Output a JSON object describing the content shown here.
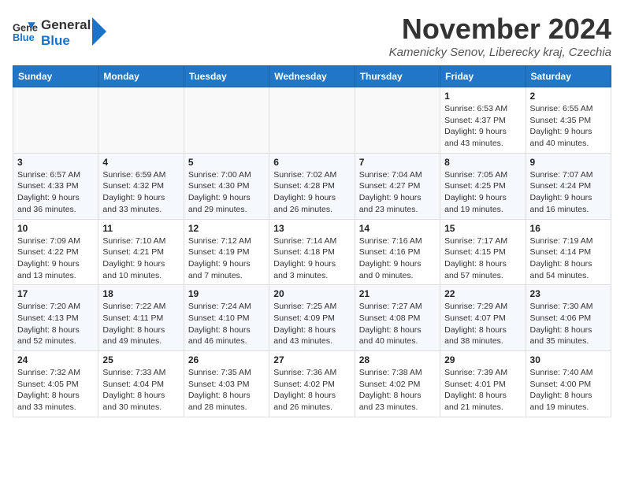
{
  "logo": {
    "line1": "General",
    "line2": "Blue"
  },
  "title": "November 2024",
  "subtitle": "Kamenicky Senov, Liberecky kraj, Czechia",
  "weekdays": [
    "Sunday",
    "Monday",
    "Tuesday",
    "Wednesday",
    "Thursday",
    "Friday",
    "Saturday"
  ],
  "weeks": [
    [
      {
        "day": "",
        "info": ""
      },
      {
        "day": "",
        "info": ""
      },
      {
        "day": "",
        "info": ""
      },
      {
        "day": "",
        "info": ""
      },
      {
        "day": "",
        "info": ""
      },
      {
        "day": "1",
        "info": "Sunrise: 6:53 AM\nSunset: 4:37 PM\nDaylight: 9 hours\nand 43 minutes."
      },
      {
        "day": "2",
        "info": "Sunrise: 6:55 AM\nSunset: 4:35 PM\nDaylight: 9 hours\nand 40 minutes."
      }
    ],
    [
      {
        "day": "3",
        "info": "Sunrise: 6:57 AM\nSunset: 4:33 PM\nDaylight: 9 hours\nand 36 minutes."
      },
      {
        "day": "4",
        "info": "Sunrise: 6:59 AM\nSunset: 4:32 PM\nDaylight: 9 hours\nand 33 minutes."
      },
      {
        "day": "5",
        "info": "Sunrise: 7:00 AM\nSunset: 4:30 PM\nDaylight: 9 hours\nand 29 minutes."
      },
      {
        "day": "6",
        "info": "Sunrise: 7:02 AM\nSunset: 4:28 PM\nDaylight: 9 hours\nand 26 minutes."
      },
      {
        "day": "7",
        "info": "Sunrise: 7:04 AM\nSunset: 4:27 PM\nDaylight: 9 hours\nand 23 minutes."
      },
      {
        "day": "8",
        "info": "Sunrise: 7:05 AM\nSunset: 4:25 PM\nDaylight: 9 hours\nand 19 minutes."
      },
      {
        "day": "9",
        "info": "Sunrise: 7:07 AM\nSunset: 4:24 PM\nDaylight: 9 hours\nand 16 minutes."
      }
    ],
    [
      {
        "day": "10",
        "info": "Sunrise: 7:09 AM\nSunset: 4:22 PM\nDaylight: 9 hours\nand 13 minutes."
      },
      {
        "day": "11",
        "info": "Sunrise: 7:10 AM\nSunset: 4:21 PM\nDaylight: 9 hours\nand 10 minutes."
      },
      {
        "day": "12",
        "info": "Sunrise: 7:12 AM\nSunset: 4:19 PM\nDaylight: 9 hours\nand 7 minutes."
      },
      {
        "day": "13",
        "info": "Sunrise: 7:14 AM\nSunset: 4:18 PM\nDaylight: 9 hours\nand 3 minutes."
      },
      {
        "day": "14",
        "info": "Sunrise: 7:16 AM\nSunset: 4:16 PM\nDaylight: 9 hours\nand 0 minutes."
      },
      {
        "day": "15",
        "info": "Sunrise: 7:17 AM\nSunset: 4:15 PM\nDaylight: 8 hours\nand 57 minutes."
      },
      {
        "day": "16",
        "info": "Sunrise: 7:19 AM\nSunset: 4:14 PM\nDaylight: 8 hours\nand 54 minutes."
      }
    ],
    [
      {
        "day": "17",
        "info": "Sunrise: 7:20 AM\nSunset: 4:13 PM\nDaylight: 8 hours\nand 52 minutes."
      },
      {
        "day": "18",
        "info": "Sunrise: 7:22 AM\nSunset: 4:11 PM\nDaylight: 8 hours\nand 49 minutes."
      },
      {
        "day": "19",
        "info": "Sunrise: 7:24 AM\nSunset: 4:10 PM\nDaylight: 8 hours\nand 46 minutes."
      },
      {
        "day": "20",
        "info": "Sunrise: 7:25 AM\nSunset: 4:09 PM\nDaylight: 8 hours\nand 43 minutes."
      },
      {
        "day": "21",
        "info": "Sunrise: 7:27 AM\nSunset: 4:08 PM\nDaylight: 8 hours\nand 40 minutes."
      },
      {
        "day": "22",
        "info": "Sunrise: 7:29 AM\nSunset: 4:07 PM\nDaylight: 8 hours\nand 38 minutes."
      },
      {
        "day": "23",
        "info": "Sunrise: 7:30 AM\nSunset: 4:06 PM\nDaylight: 8 hours\nand 35 minutes."
      }
    ],
    [
      {
        "day": "24",
        "info": "Sunrise: 7:32 AM\nSunset: 4:05 PM\nDaylight: 8 hours\nand 33 minutes."
      },
      {
        "day": "25",
        "info": "Sunrise: 7:33 AM\nSunset: 4:04 PM\nDaylight: 8 hours\nand 30 minutes."
      },
      {
        "day": "26",
        "info": "Sunrise: 7:35 AM\nSunset: 4:03 PM\nDaylight: 8 hours\nand 28 minutes."
      },
      {
        "day": "27",
        "info": "Sunrise: 7:36 AM\nSunset: 4:02 PM\nDaylight: 8 hours\nand 26 minutes."
      },
      {
        "day": "28",
        "info": "Sunrise: 7:38 AM\nSunset: 4:02 PM\nDaylight: 8 hours\nand 23 minutes."
      },
      {
        "day": "29",
        "info": "Sunrise: 7:39 AM\nSunset: 4:01 PM\nDaylight: 8 hours\nand 21 minutes."
      },
      {
        "day": "30",
        "info": "Sunrise: 7:40 AM\nSunset: 4:00 PM\nDaylight: 8 hours\nand 19 minutes."
      }
    ]
  ]
}
